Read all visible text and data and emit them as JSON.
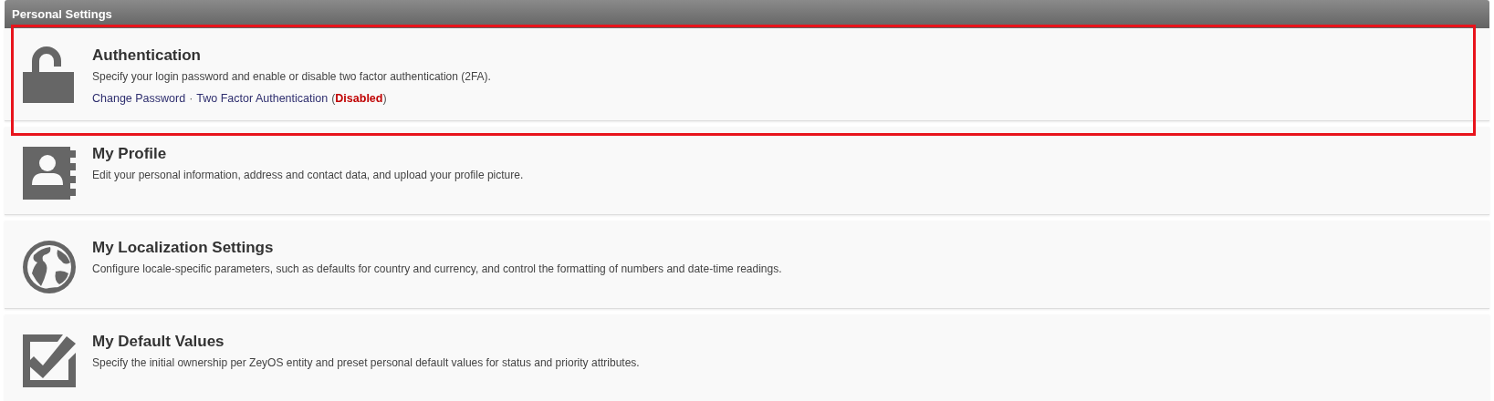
{
  "panel": {
    "title": "Personal Settings"
  },
  "items": [
    {
      "kind": "lock",
      "title": "Authentication",
      "description": "Specify your login password and enable or disable two factor authentication (2FA).",
      "highlighted": true,
      "links": [
        {
          "label": "Change Password"
        },
        {
          "label": "Two Factor Authentication",
          "status": {
            "open": "(",
            "label": "Disabled",
            "close": ")",
            "enabled": false
          }
        }
      ],
      "separator": "·"
    },
    {
      "kind": "profile",
      "title": "My Profile",
      "description": "Edit your personal information, address and contact data, and upload your profile picture.",
      "highlighted": false
    },
    {
      "kind": "globe",
      "title": "My Localization Settings",
      "description": "Configure locale-specific parameters, such as defaults for country and currency, and control the formatting of numbers and date-time readings.",
      "highlighted": false
    },
    {
      "kind": "checkbox",
      "title": "My Default Values",
      "description": "Specify the initial ownership per ZeyOS entity and preset personal default values for status and priority attributes.",
      "highlighted": false
    }
  ]
}
